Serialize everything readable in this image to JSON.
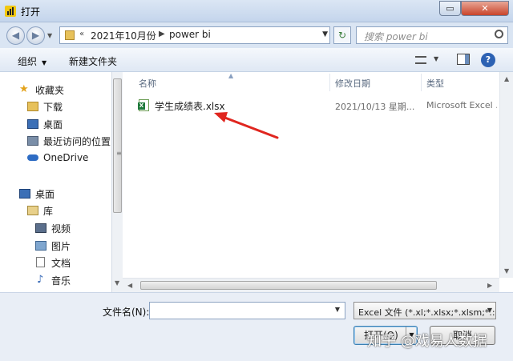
{
  "window": {
    "title": "打开",
    "maximize_label": "▭",
    "close_label": "✕"
  },
  "address": {
    "breadcrumb_prefix": "«",
    "breadcrumbs": [
      "2021年10月份",
      "power bi"
    ],
    "search_placeholder": "搜索 power bi"
  },
  "toolbar": {
    "organize_label": "组织",
    "new_folder_label": "新建文件夹",
    "help_label": "?"
  },
  "nav": {
    "favorites_label": "收藏夹",
    "favorites": [
      "下载",
      "桌面",
      "最近访问的位置"
    ],
    "onedrive_label": "OneDrive",
    "desktop_label": "桌面",
    "library_label": "库",
    "libraries": [
      "视频",
      "图片",
      "文档",
      "音乐"
    ]
  },
  "columns": {
    "name": "名称",
    "modified": "修改日期",
    "type": "类型"
  },
  "files": [
    {
      "name": "学生成绩表.xlsx",
      "modified": "2021/10/13 星期...",
      "type": "Microsoft Excel ..."
    }
  ],
  "bottom": {
    "filename_label": "文件名(N):",
    "filename_value": "",
    "filter_value": "Excel 文件 (*.xl;*.xlsx;*.xlsm;*.:",
    "open_label": "打开(O)",
    "cancel_label": "取消"
  },
  "watermark": "知乎 @戏易人数据",
  "colors": {
    "annotation_arrow": "#e0261f",
    "titlebar": "#c4d5ec",
    "accent": "#2d62b3"
  }
}
